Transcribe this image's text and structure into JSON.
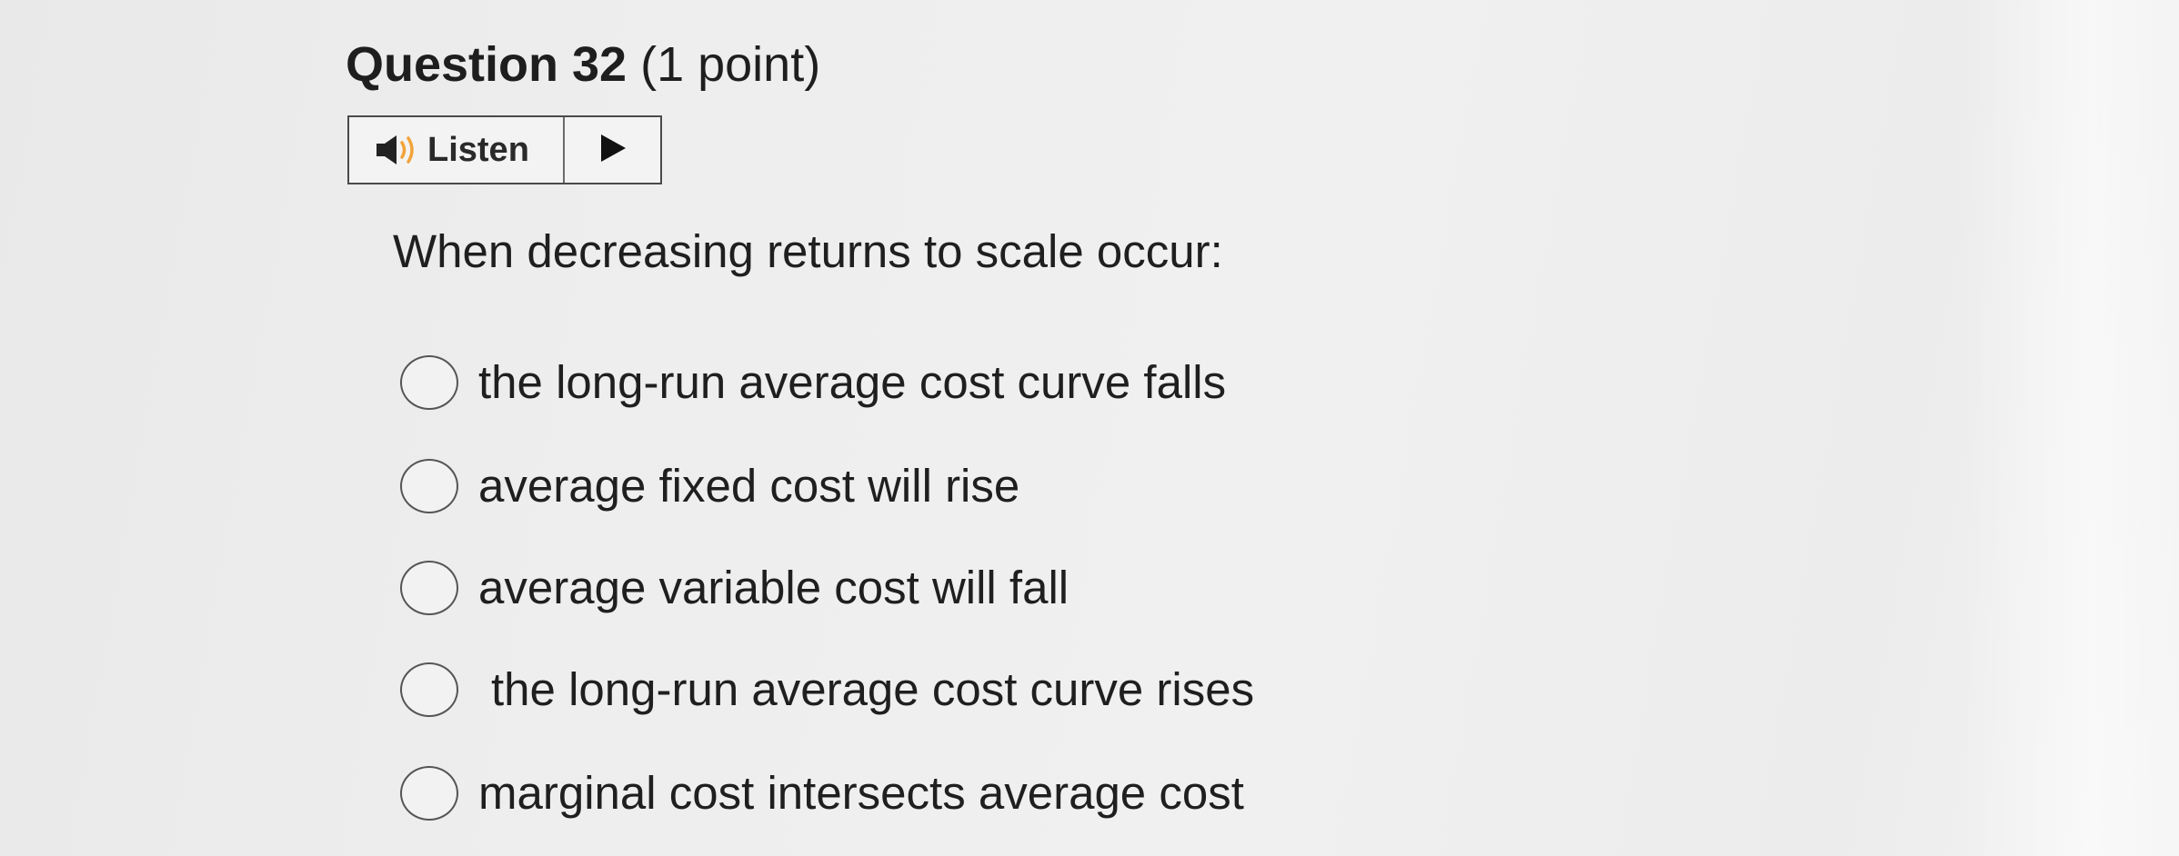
{
  "question": {
    "number_label": "Question 32",
    "points_label": "(1 point)"
  },
  "listen": {
    "label": "Listen",
    "icons": [
      "speaker-icon",
      "play-icon"
    ]
  },
  "prompt": "When decreasing returns to scale occur:",
  "options": [
    {
      "label": "the long-run average cost curve falls",
      "selected": false
    },
    {
      "label": "average fixed cost will rise",
      "selected": false
    },
    {
      "label": "average variable cost will fall",
      "selected": false
    },
    {
      "label": "the long-run average cost curve rises",
      "selected": false
    },
    {
      "label": "marginal cost intersects average cost",
      "selected": false
    }
  ]
}
